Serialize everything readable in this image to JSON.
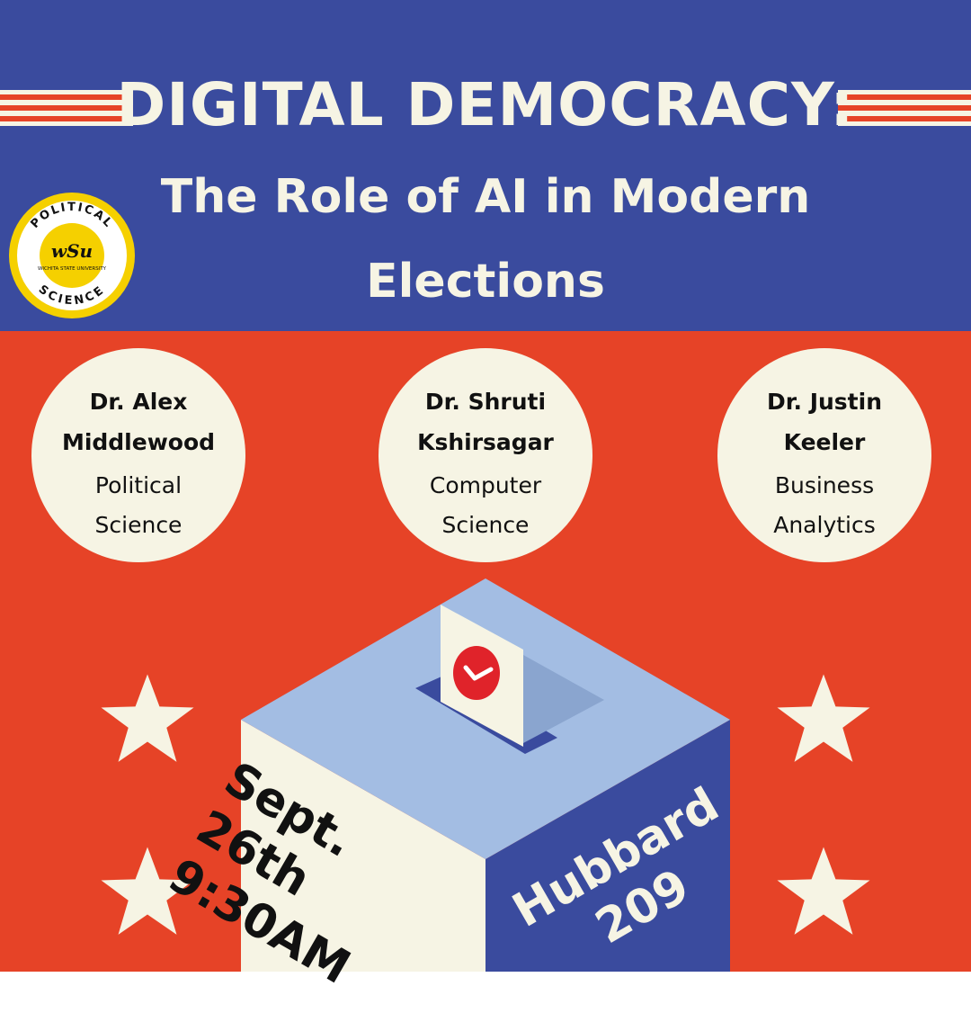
{
  "title": {
    "line1": "DIGITAL DEMOCRACY:",
    "line2": "The Role of AI in Modern Elections"
  },
  "logo": {
    "top_text": "POLITICAL",
    "bottom_text": "SCIENCE",
    "mark": "wSu",
    "university": "WICHITA STATE UNIVERSITY"
  },
  "speakers": [
    {
      "name_line1": "Dr. Alex",
      "name_line2": "Middlewood",
      "dept_line1": "Political",
      "dept_line2": "Science"
    },
    {
      "name_line1": "Dr. Shruti",
      "name_line2": "Kshirsagar",
      "dept_line1": "Computer",
      "dept_line2": "Science"
    },
    {
      "name_line1": "Dr. Justin",
      "name_line2": "Keeler",
      "dept_line1": "Business",
      "dept_line2": "Analytics"
    }
  ],
  "event": {
    "date": "Sept. 26th",
    "time": "9:30AM",
    "room_line1": "Hubbard",
    "room_line2": "209"
  },
  "icons": [
    "star-icon",
    "ballot-box-icon",
    "checkmark-icon"
  ],
  "colors": {
    "blue": "#3a4b9e",
    "red": "#e64327",
    "cream": "#f6f4e4",
    "light_blue": "#a3bde3",
    "logo_yellow": "#f5d000"
  }
}
